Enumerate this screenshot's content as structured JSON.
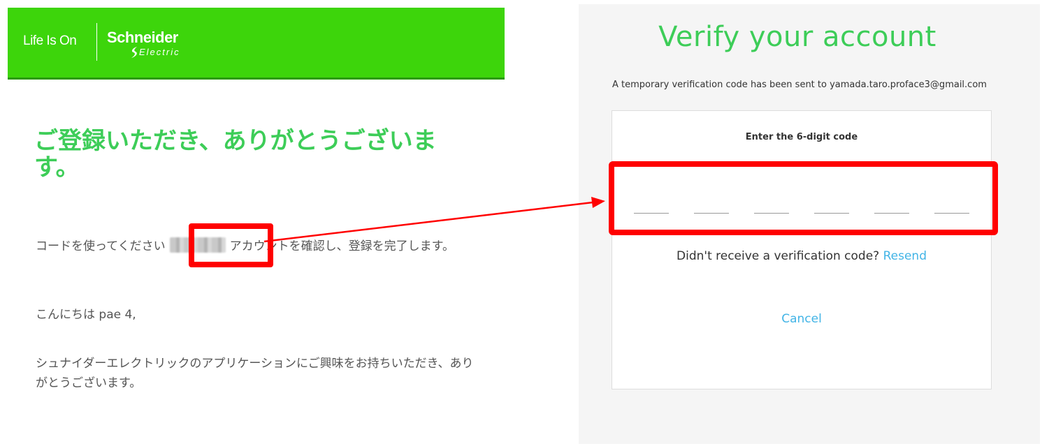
{
  "email": {
    "header": {
      "tagline": "Life Is On",
      "brand_name": "Schneider",
      "brand_sub": "Electric",
      "background": "#3dd50b"
    },
    "title": "ご登録いただき、ありがとうございます。",
    "code_sentence_before": "コードを使ってください",
    "code_sentence_after": "アカウントを確認し、登録を完了します。",
    "greeting": "こんにちは pae 4,",
    "thanks": "シュナイダーエレクトリックのアプリケーションにご興味をお持ちいただき、ありがとうございます。"
  },
  "verify": {
    "title": "Verify your account",
    "note": "A temporary verification code has been sent to yamada.taro.proface3@gmail.com",
    "code_label": "Enter the 6-digit code",
    "code_fields": [
      "",
      "",
      "",
      "",
      "",
      ""
    ],
    "resend_prompt": "Didn't receive a verification code? ",
    "resend_label": "Resend",
    "cancel_label": "Cancel"
  },
  "colors": {
    "brand_green": "#3dcd58",
    "link_blue": "#42b4e6",
    "annotation_red": "#ff0000"
  }
}
